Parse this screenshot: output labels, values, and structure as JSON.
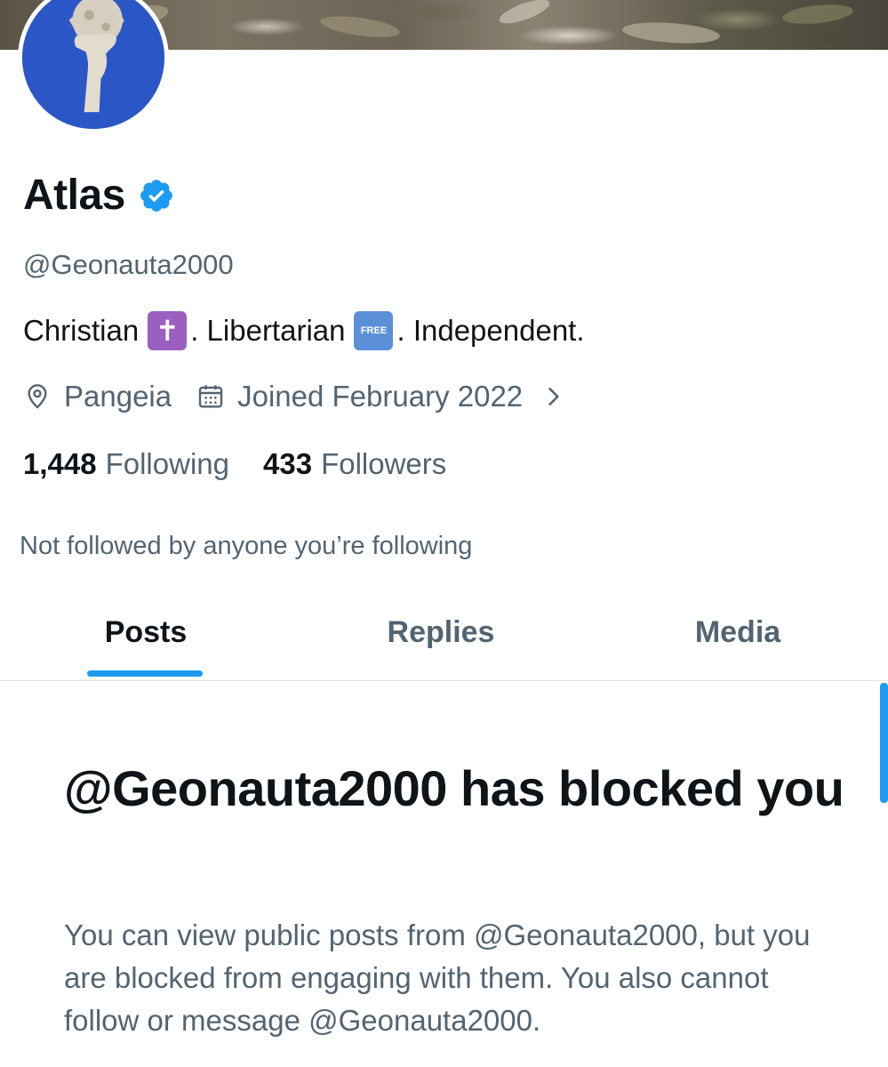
{
  "profile": {
    "display_name": "Atlas",
    "handle": "@Geonauta2000",
    "verified": true,
    "verified_icon": "verified-badge-icon",
    "bio": {
      "part1": "Christian",
      "cross_emoji": "✝",
      "part2": ". Libertarian",
      "free_emoji": "FREE",
      "part3": ". Independent."
    },
    "location": "Pangeia",
    "joined": "Joined February 2022",
    "following_count": "1,448",
    "following_label": "Following",
    "followers_count": "433",
    "followers_label": "Followers",
    "not_followed_text": "Not followed by anyone you’re following"
  },
  "tabs": [
    {
      "label": "Posts",
      "active": true
    },
    {
      "label": "Replies",
      "active": false
    },
    {
      "label": "Media",
      "active": false
    }
  ],
  "blocked": {
    "title": "@Geonauta2000 has blocked you",
    "body": "You can view public posts from @Geonauta2000, but you are blocked from engaging with them. You also cannot follow or message @Geonauta2000."
  },
  "colors": {
    "accent": "#1d9bf0",
    "text_primary": "#0f1419",
    "text_secondary": "#536471",
    "avatar_bg": "#2a56c6"
  }
}
